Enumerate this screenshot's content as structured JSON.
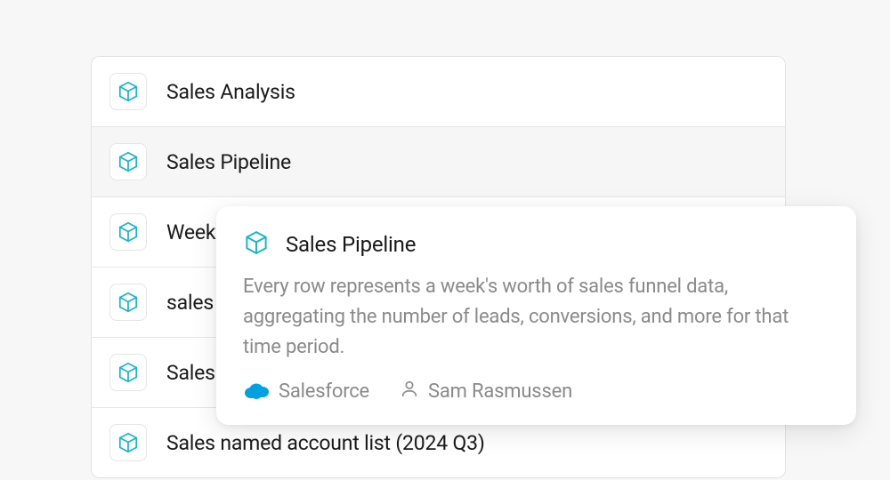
{
  "list": {
    "items": [
      {
        "label": "Sales Analysis"
      },
      {
        "label": "Sales Pipeline"
      },
      {
        "label": "Weekly"
      },
      {
        "label": "sales"
      },
      {
        "label": "Sales"
      },
      {
        "label": "Sales named account list (2024 Q3)"
      }
    ]
  },
  "popover": {
    "title": "Sales Pipeline",
    "description": "Every row represents a week's worth of sales funnel data, aggregating the number of leads, conversions, and more for that time period.",
    "source_label": "Salesforce",
    "owner_label": "Sam Rasmussen"
  },
  "colors": {
    "icon_teal": "#1ab5c9",
    "salesforce_blue": "#00a1e0"
  }
}
